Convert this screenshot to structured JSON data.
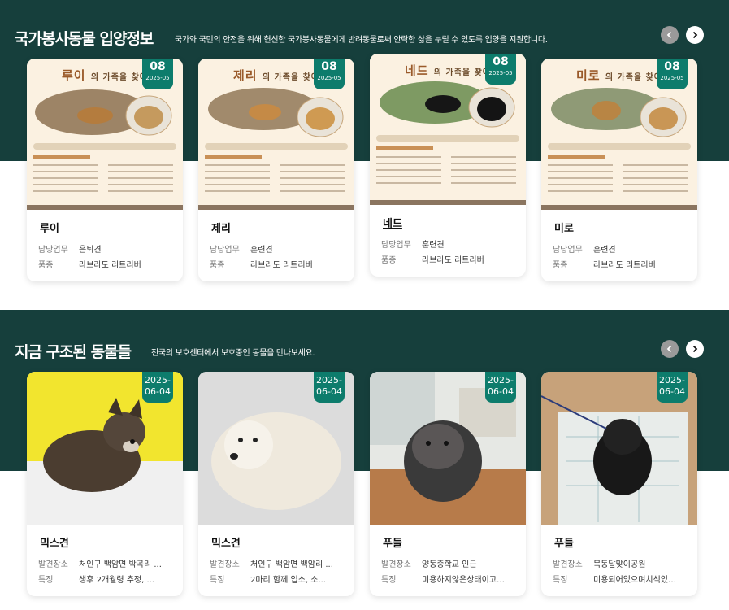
{
  "adoption": {
    "title": "국가봉사동물 입양정보",
    "subtitle": "국가와 국민의 안전을 위해 헌신한 국가봉사동물에게 반려동물로써 안락한 삶을 누릴 수 있도록 입양을 지원합니다.",
    "labels": {
      "duty": "담당업무",
      "breed": "품종"
    },
    "poster_suffix": "의 가족을 찾아",
    "cards": [
      {
        "name": "루이",
        "day": "08",
        "ym": "2025-05",
        "duty": "은퇴견",
        "breed": "라브라도 리트리버"
      },
      {
        "name": "제리",
        "day": "08",
        "ym": "2025-05",
        "duty": "훈련견",
        "breed": "라브라도 리트리버"
      },
      {
        "name": "네드",
        "day": "08",
        "ym": "2025-05",
        "duty": "훈련견",
        "breed": "라브라도 리트리버"
      },
      {
        "name": "미로",
        "day": "08",
        "ym": "2025-05",
        "duty": "훈련견",
        "breed": "라브라도 리트리버"
      }
    ]
  },
  "rescued": {
    "title": "지금 구조된 동물들",
    "subtitle": "전국의 보호센터에서 보호중인 동물을 만나보세요.",
    "labels": {
      "place": "발견장소",
      "feature": "특징"
    },
    "cards": [
      {
        "name": "믹스견",
        "date": "2025-\n06-04",
        "place": "처인구 백암면 박곡리 ...",
        "feature": "생후 2개월령 추정, ..."
      },
      {
        "name": "믹스견",
        "date": "2025-\n06-04",
        "place": "처인구 백암면 백암리 ...",
        "feature": "2마리 함께 입소, 소..."
      },
      {
        "name": "푸들",
        "date": "2025-\n06-04",
        "place": "양동중학교 인근",
        "feature": "미용하지않은상태이고온순"
      },
      {
        "name": "푸들",
        "date": "2025-\n06-04",
        "place": "목동달맞이공원",
        "feature": "미용되어있으며치석있고한"
      }
    ]
  },
  "colors": {
    "band": "#163f3c",
    "badge": "#0d7c6c"
  },
  "icons": [
    "chevron-left-icon",
    "chevron-right-icon"
  ]
}
